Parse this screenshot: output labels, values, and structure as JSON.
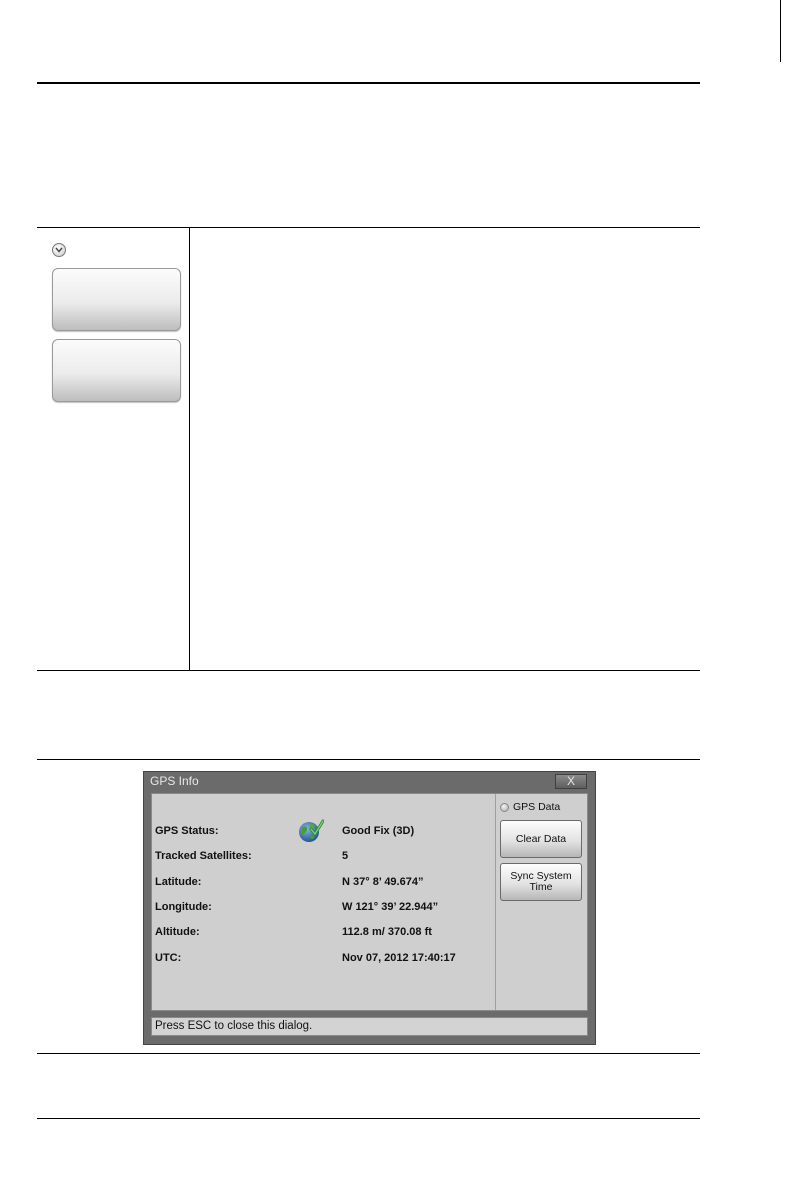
{
  "softkey_panel": {
    "chevron_icon": "chevron-down-icon",
    "softkeys": [
      "",
      ""
    ]
  },
  "gps_dialog": {
    "title": "GPS Info",
    "close_label": "X",
    "status_icon": "globe-check-icon",
    "fields": [
      {
        "label": "GPS Status:",
        "value": "Good Fix (3D)"
      },
      {
        "label": "Tracked Satellites:",
        "value": "5"
      },
      {
        "label": "Latitude:",
        "value": "N 37° 8’ 49.674”"
      },
      {
        "label": "Longitude:",
        "value": "W 121° 39’ 22.944”"
      },
      {
        "label": "Altitude:",
        "value": "112.8 m/ 370.08 ft"
      },
      {
        "label": "UTC:",
        "value": "Nov 07, 2012 17:40:17"
      }
    ],
    "side_panel": {
      "radio_label": "GPS Data",
      "clear_button": "Clear Data",
      "sync_button_line1": "Sync System",
      "sync_button_line2": "Time"
    },
    "status_text": "Press ESC to close this dialog."
  }
}
